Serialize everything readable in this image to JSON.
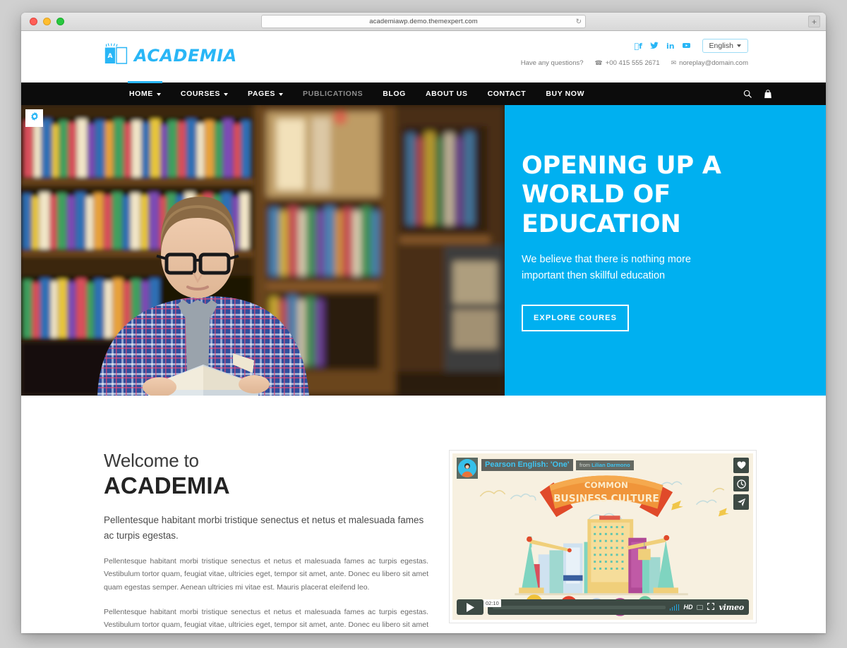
{
  "browser": {
    "url": "academiawp.demo.themexpert.com",
    "reload_icon": "reload-icon",
    "newtab_label": "+",
    "traffic_lights": [
      "close",
      "minimize",
      "zoom"
    ]
  },
  "header": {
    "logo_text": "ACADEMIA",
    "logo_icon": "open-book-icon",
    "social": [
      {
        "name": "facebook-icon",
        "glyph": "f"
      },
      {
        "name": "twitter-icon",
        "glyph": "t"
      },
      {
        "name": "linkedin-icon",
        "glyph": "in"
      },
      {
        "name": "youtube-icon",
        "glyph": "yt"
      }
    ],
    "language": {
      "label": "English",
      "caret": "chevron-down-icon"
    },
    "questions_label": "Have any questions?",
    "phone": "+00 415 555 2671",
    "email": "noreplay@domain.com"
  },
  "nav": {
    "items": [
      {
        "label": "HOME",
        "has_caret": true,
        "active": true,
        "muted": false
      },
      {
        "label": "COURSES",
        "has_caret": true,
        "active": false,
        "muted": false
      },
      {
        "label": "PAGES",
        "has_caret": true,
        "active": false,
        "muted": false
      },
      {
        "label": "PUBLICATIONS",
        "has_caret": false,
        "active": false,
        "muted": true
      },
      {
        "label": "BLOG",
        "has_caret": false,
        "active": false,
        "muted": false
      },
      {
        "label": "ABOUT US",
        "has_caret": false,
        "active": false,
        "muted": false
      },
      {
        "label": "CONTACT",
        "has_caret": false,
        "active": false,
        "muted": false
      },
      {
        "label": "BUY NOW",
        "has_caret": false,
        "active": false,
        "muted": false
      }
    ],
    "search_icon": "search-icon",
    "cart_icon": "shopping-bag-icon"
  },
  "hero": {
    "settings_icon": "gear-icon",
    "title_line1": "OPENING UP A",
    "title_line2": "WORLD OF",
    "title_line3": "EDUCATION",
    "subtitle_line1": "We believe that there is nothing more",
    "subtitle_line2": "important then skillful education",
    "cta_label": "EXPLORE COURES",
    "bg_color": "#00b0f0",
    "image_alt": "Student with glasses reading a book in a library"
  },
  "welcome": {
    "eyebrow": "Welcome to",
    "title": "ACADEMIA",
    "lead": "Pellentesque habitant morbi tristique senectus et netus et malesuada fames ac turpis egestas.",
    "paragraphs": [
      "Pellentesque habitant morbi tristique senectus et netus et malesuada fames ac turpis egestas. Vestibulum tortor quam, feugiat vitae, ultricies eget, tempor sit amet, ante. Donec eu libero sit amet quam egestas semper. Aenean ultricies mi vitae est. Mauris placerat eleifend leo.",
      "Pellentesque habitant morbi tristique senectus et netus et malesuada fames ac turpis egestas. Vestibulum tortor quam, feugiat vitae, ultricies eget, tempor sit amet, ante. Donec eu libero sit amet quam egestas semper. Aenean ultricies mi vitae est."
    ]
  },
  "video": {
    "title": "Pearson English: 'One'",
    "from_label": "from",
    "author": "Lilian Darmono",
    "banner_line1": "COMMON",
    "banner_line2": "BUSINESS CULTURE",
    "time": "02:10",
    "quality": "HD",
    "provider": "vimeo",
    "play_icon": "play-icon",
    "actions": [
      {
        "name": "like-heart-icon"
      },
      {
        "name": "watch-later-clock-icon"
      },
      {
        "name": "share-send-icon"
      }
    ],
    "cc_icon": "closed-caption-icon",
    "fullscreen_icon": "fullscreen-icon",
    "volume_icon": "volume-icon"
  }
}
